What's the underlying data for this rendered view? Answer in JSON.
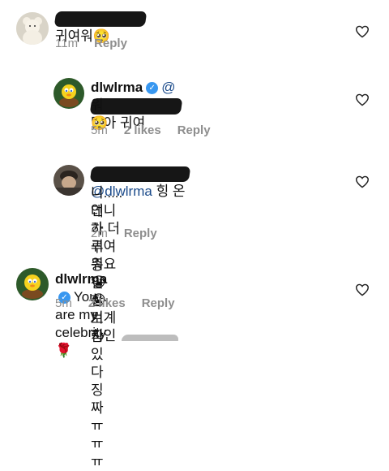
{
  "comments": [
    {
      "text": "귀여워🥺",
      "time": "11m",
      "reply": "Reply"
    },
    {
      "username": "dlwlrma",
      "line1_suffix": "맞아 귀여",
      "line2": "워🥺",
      "time": "5m",
      "likes": "2 likes",
      "reply": "Reply"
    },
    {
      "mention": "@dlwlrma",
      "line1_suffix": "힝 온",
      "line2": "니..... 언니가 더 귀여워요😭😭 기계치인",
      "line3": "데 하루종일 한 보람있다 징짜ㅠㅠㅠ",
      "time": "2m",
      "reply": "Reply"
    },
    {
      "username": "dlwlrma",
      "text": "You are my celebrity 🌹",
      "time": "5m",
      "likes": "2 likes",
      "reply": "Reply"
    }
  ],
  "icons": {
    "verified": "verified-badge-icon",
    "like": "heart-outline-icon"
  },
  "colors": {
    "meta": "#8e8e8e",
    "verified": "#3897f0",
    "mention": "#1a4a8a"
  }
}
